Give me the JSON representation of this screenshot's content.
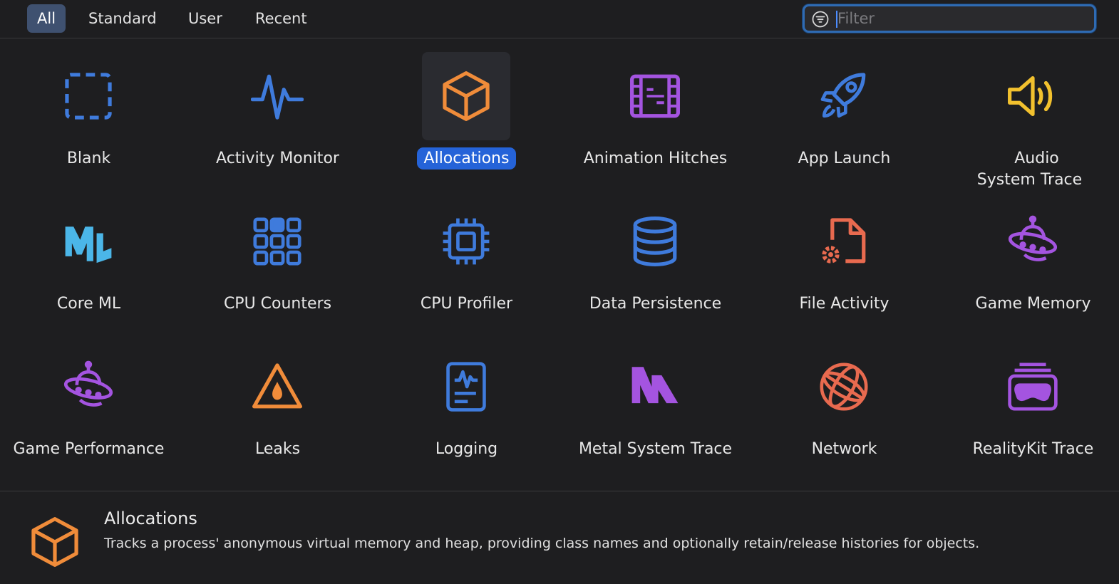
{
  "tabs": [
    {
      "label": "All",
      "active": true
    },
    {
      "label": "Standard",
      "active": false
    },
    {
      "label": "User",
      "active": false
    },
    {
      "label": "Recent",
      "active": false
    }
  ],
  "filter": {
    "placeholder": "Filter",
    "value": "",
    "icon": "filter-icon"
  },
  "templates": [
    {
      "label": "Blank",
      "icon": "dashed-square-icon",
      "color": "#3f7bdc"
    },
    {
      "label": "Activity Monitor",
      "icon": "pulse-icon",
      "color": "#3f7bdc"
    },
    {
      "label": "Allocations",
      "icon": "cube-icon",
      "color": "#f08c3a",
      "selected": true
    },
    {
      "label": "Animation Hitches",
      "icon": "film-strip-icon",
      "color": "#a454e0"
    },
    {
      "label": "App Launch",
      "icon": "rocket-icon",
      "color": "#3f7bdc"
    },
    {
      "label": "Audio System Trace",
      "icon": "speaker-icon",
      "color": "#f2c12e"
    },
    {
      "label": "Core ML",
      "icon": "ml-logo-icon",
      "color": "#4bb6e8"
    },
    {
      "label": "CPU Counters",
      "icon": "counters-grid-icon",
      "color": "#3f7bdc"
    },
    {
      "label": "CPU Profiler",
      "icon": "cpu-chip-icon",
      "color": "#3f7bdc"
    },
    {
      "label": "Data Persistence",
      "icon": "database-icon",
      "color": "#3f7bdc"
    },
    {
      "label": "File Activity",
      "icon": "document-gear-icon",
      "color": "#e86a4f"
    },
    {
      "label": "Game Memory",
      "icon": "ufo-icon",
      "color": "#a454e0"
    },
    {
      "label": "Game Performance",
      "icon": "ufo-icon",
      "color": "#a454e0"
    },
    {
      "label": "Leaks",
      "icon": "warning-drop-icon",
      "color": "#f08c3a"
    },
    {
      "label": "Logging",
      "icon": "log-document-icon",
      "color": "#3f7bdc"
    },
    {
      "label": "Metal System Trace",
      "icon": "metal-logo-icon",
      "color": "#a454e0"
    },
    {
      "label": "Network",
      "icon": "globe-icon",
      "color": "#e86a4f"
    },
    {
      "label": "RealityKit Trace",
      "icon": "vision-headset-icon",
      "color": "#a454e0"
    }
  ],
  "details": {
    "title": "Allocations",
    "description": "Tracks a process' anonymous virtual memory and heap, providing class names and optionally retain/release histories for objects.",
    "icon": "cube-icon",
    "color": "#f08c3a"
  }
}
